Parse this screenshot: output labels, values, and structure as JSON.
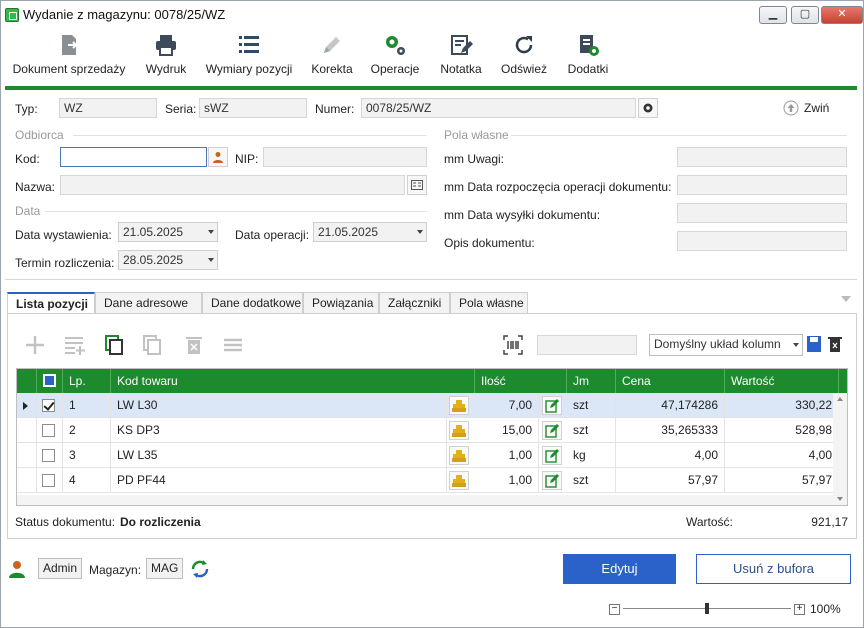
{
  "window": {
    "title": "Wydanie z magazynu: 0078/25/WZ"
  },
  "toolbar": [
    {
      "id": "dokument",
      "label": "Dokument sprzedaży",
      "icon": "document-arrow-icon"
    },
    {
      "id": "wydruk",
      "label": "Wydruk",
      "icon": "printer-icon"
    },
    {
      "id": "wymiary",
      "label": "Wymiary pozycji",
      "icon": "list-icon"
    },
    {
      "id": "korekta",
      "label": "Korekta",
      "icon": "pencil-icon"
    },
    {
      "id": "operacje",
      "label": "Operacje",
      "icon": "gears-icon"
    },
    {
      "id": "notatka",
      "label": "Notatka",
      "icon": "note-icon"
    },
    {
      "id": "odswiez",
      "label": "Odśwież",
      "icon": "refresh-icon"
    },
    {
      "id": "dodatki",
      "label": "Dodatki",
      "icon": "document-gear-icon"
    }
  ],
  "header": {
    "typ_label": "Typ:",
    "typ": "WZ",
    "seria_label": "Seria:",
    "seria": "sWZ",
    "numer_label": "Numer:",
    "numer": "0078/25/WZ",
    "zwin": "Zwiń"
  },
  "odbiorca": {
    "section": "Odbiorca",
    "kod_label": "Kod:",
    "kod": "",
    "nip_label": "NIP:",
    "nip": "",
    "nazwa_label": "Nazwa:",
    "nazwa": ""
  },
  "data_section": {
    "section": "Data",
    "wystawienia_label": "Data wystawienia:",
    "wystawienia": "21.05.2025",
    "operacji_label": "Data operacji:",
    "operacji": "21.05.2025",
    "termin_label": "Termin rozliczenia:",
    "termin": "28.05.2025"
  },
  "pola_wlasne": {
    "section": "Pola własne",
    "uwagi": "mm Uwagi:",
    "data_rozp": "mm Data rozpoczęcia operacji dokumentu:",
    "data_wysylki": "mm Data wysyłki dokumentu:",
    "opis": "Opis dokumentu:"
  },
  "tabs": [
    "Lista pozycji",
    "Dane adresowe",
    "Dane dodatkowe",
    "Powiązania",
    "Załączniki",
    "Pola własne"
  ],
  "grid_toolbar": {
    "layout_select": "Domyślny układ kolumn",
    "search": ""
  },
  "grid": {
    "columns": [
      "Lp.",
      "Kod towaru",
      "Ilość",
      "Jm",
      "Cena",
      "Wartość"
    ],
    "rows": [
      {
        "lp": "1",
        "kod": "LW L30",
        "ilosc": "7,00",
        "jm": "szt",
        "cena": "47,174286",
        "wartosc": "330,22",
        "checked": true,
        "selected": true
      },
      {
        "lp": "2",
        "kod": "KS DP3",
        "ilosc": "15,00",
        "jm": "szt",
        "cena": "35,265333",
        "wartosc": "528,98",
        "checked": false,
        "selected": false
      },
      {
        "lp": "3",
        "kod": "LW L35",
        "ilosc": "1,00",
        "jm": "kg",
        "cena": "4,00",
        "wartosc": "4,00",
        "checked": false,
        "selected": false
      },
      {
        "lp": "4",
        "kod": "PD PF44",
        "ilosc": "1,00",
        "jm": "szt",
        "cena": "57,97",
        "wartosc": "57,97",
        "checked": false,
        "selected": false
      }
    ]
  },
  "status": {
    "label": "Status dokumentu:",
    "value": "Do rozliczenia",
    "wartosc_label": "Wartość:",
    "wartosc": "921,17"
  },
  "footer": {
    "user": "Admin",
    "magazyn_label": "Magazyn:",
    "magazyn": "MAG",
    "edit": "Edytuj",
    "remove": "Usuń z bufora",
    "zoom": "100%"
  },
  "colors": {
    "accent_green": "#1e8a2e",
    "primary_blue": "#2a62c9"
  }
}
